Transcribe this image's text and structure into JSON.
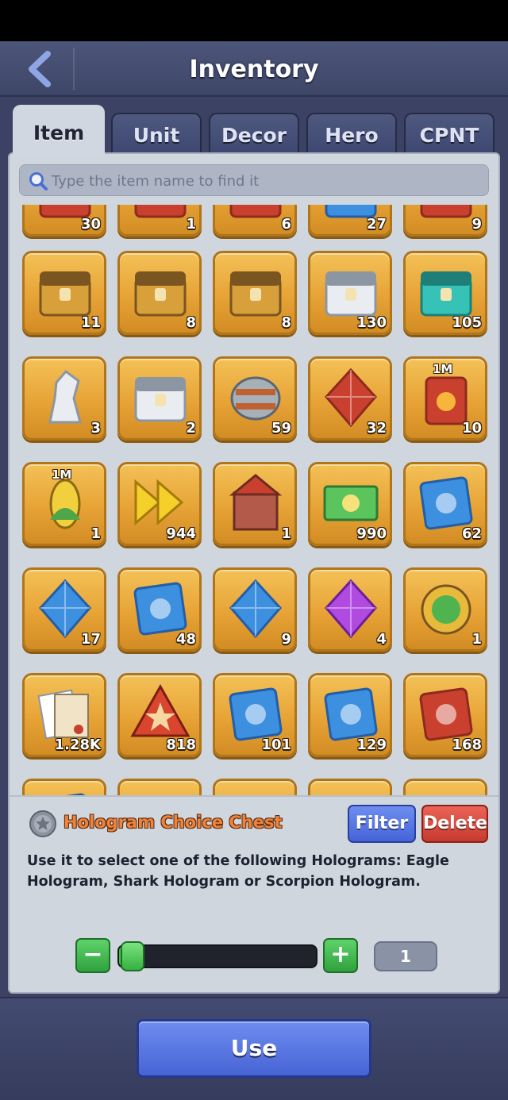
{
  "header": {
    "title": "Inventory",
    "back_icon": "chevron-left-icon"
  },
  "tabs": [
    {
      "label": "Item",
      "active": true
    },
    {
      "label": "Unit",
      "active": false
    },
    {
      "label": "Decor",
      "active": false
    },
    {
      "label": "Hero",
      "active": false
    },
    {
      "label": "CPNT",
      "active": false
    }
  ],
  "search": {
    "placeholder": "Type the item name to find it"
  },
  "grid": {
    "rows": [
      [
        {
          "icon": "red-chest-icon",
          "count": "30"
        },
        {
          "icon": "red-chest-icon",
          "count": "1"
        },
        {
          "icon": "red-chest-icon",
          "count": "6"
        },
        {
          "icon": "blue-crate-icon",
          "count": "27"
        },
        {
          "icon": "red-chest-icon",
          "count": "9"
        }
      ],
      [
        {
          "icon": "gold-crate-meat-icon",
          "count": "11"
        },
        {
          "icon": "gold-crate-speedup-icon",
          "count": "8"
        },
        {
          "icon": "gold-crate-puzzle-icon",
          "count": "8"
        },
        {
          "icon": "orange-white-chest-icon",
          "count": "130"
        },
        {
          "icon": "teal-speedup-chest-icon",
          "count": "105"
        }
      ],
      [
        {
          "icon": "white-statue-icon",
          "count": "3"
        },
        {
          "icon": "orange-white-chest-icon",
          "count": "2"
        },
        {
          "icon": "steel-barrel-icon",
          "count": "59"
        },
        {
          "icon": "red-crystal-icon",
          "count": "32"
        },
        {
          "icon": "fuel-can-icon",
          "count": "10",
          "badge": "1M"
        }
      ],
      [
        {
          "icon": "corn-icon",
          "count": "1",
          "badge": "1M"
        },
        {
          "icon": "speedup-arrows-icon",
          "count": "944"
        },
        {
          "icon": "castle-decor-icon",
          "count": "1"
        },
        {
          "icon": "cash-bundle-icon",
          "count": "990"
        },
        {
          "icon": "scorpion-blueprint-icon",
          "count": "62"
        }
      ],
      [
        {
          "icon": "scorpion-crystal-icon",
          "count": "17"
        },
        {
          "icon": "eagle-blueprint-icon",
          "count": "48"
        },
        {
          "icon": "eagle-crystal-icon",
          "count": "9"
        },
        {
          "icon": "purple-crystal-icon",
          "count": "4"
        },
        {
          "icon": "gold-medal-icon",
          "count": "1"
        }
      ],
      [
        {
          "icon": "documents-icon",
          "count": "1.28K"
        },
        {
          "icon": "star-badge-icon",
          "count": "818"
        },
        {
          "icon": "blue-scroll-icon",
          "count": "101"
        },
        {
          "icon": "blue-scroll-icon",
          "count": "129"
        },
        {
          "icon": "red-scroll-icon",
          "count": "168"
        }
      ],
      [
        {
          "icon": "blue-scroll-icon",
          "count": ""
        },
        {
          "icon": "teal-item-icon",
          "count": ""
        },
        {
          "icon": "gold-coins-icon",
          "count": ""
        },
        {
          "icon": "gold-coins-icon",
          "count": ""
        },
        {
          "icon": "gold-coins-icon",
          "count": ""
        }
      ]
    ]
  },
  "detail": {
    "name": "Hologram Choice Chest",
    "description": "Use it to select one of the following Holograms: Eagle Hologram, Shark Hologram or Scorpion Hologram.",
    "filter_label": "Filter",
    "delete_label": "Delete"
  },
  "quantity": {
    "value": "1",
    "minus_label": "−",
    "plus_label": "+",
    "fraction": 0.0
  },
  "use_label": "Use",
  "colors": {
    "accent_blue": "#4764d4",
    "delete_red": "#c73b2f",
    "slot_gold": "#e7a336",
    "name_orange": "#f0833a"
  }
}
